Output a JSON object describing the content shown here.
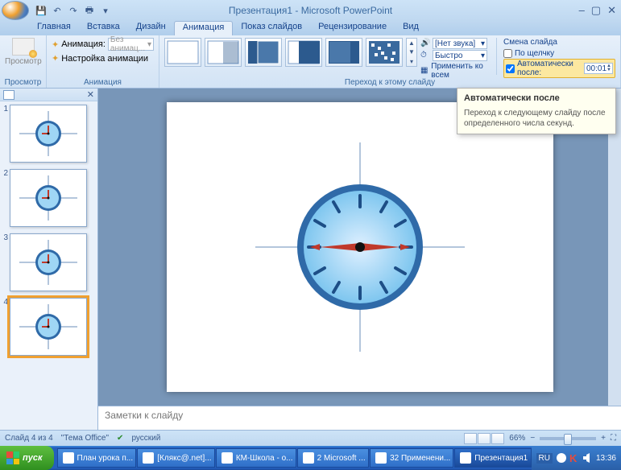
{
  "title": "Презентация1 - Microsoft PowerPoint",
  "qat": {
    "save": "💾",
    "undo": "↶",
    "redo": "↷",
    "print": "🖶"
  },
  "tabs": {
    "home": "Главная",
    "insert": "Вставка",
    "design": "Дизайн",
    "animations": "Анимация",
    "slideshow": "Показ слайдов",
    "review": "Рецензирование",
    "view": "Вид"
  },
  "ribbon": {
    "preview": {
      "label": "Просмотр",
      "group": "Просмотр"
    },
    "anim": {
      "animate_label": "Анимация:",
      "animate_value": "Без анимац...",
      "custom": "Настройка анимации",
      "group": "Анимация"
    },
    "transition": {
      "sound_icon": "🔊",
      "sound_value": "[Нет звука]",
      "speed_icon": "⏱",
      "speed_value": "Быстро",
      "apply_all": "Применить ко всем",
      "group": "Переход к этому слайду"
    },
    "advance": {
      "title": "Смена слайда",
      "on_click": "По щелчку",
      "auto_after": "Автоматически после:",
      "auto_value": "00:01"
    }
  },
  "tooltip": {
    "title": "Автоматически после",
    "body": "Переход к следующему слайду после определенного числа секунд."
  },
  "slides": [
    {
      "num": "1"
    },
    {
      "num": "2"
    },
    {
      "num": "3"
    },
    {
      "num": "4"
    }
  ],
  "selected_slide": 4,
  "notes_placeholder": "Заметки к слайду",
  "status": {
    "slide_of": "Слайд 4 из 4",
    "theme": "\"Тема Office\"",
    "lang": "русский",
    "zoom": "66%"
  },
  "taskbar": {
    "start": "пуск",
    "items": [
      "План урока п...",
      "[Клякс@.net]...",
      "КМ-Школа - о...",
      "2 Microsoft ...",
      "32 Применени...",
      "Презентация1"
    ],
    "lang": "RU",
    "time": "13:36"
  }
}
